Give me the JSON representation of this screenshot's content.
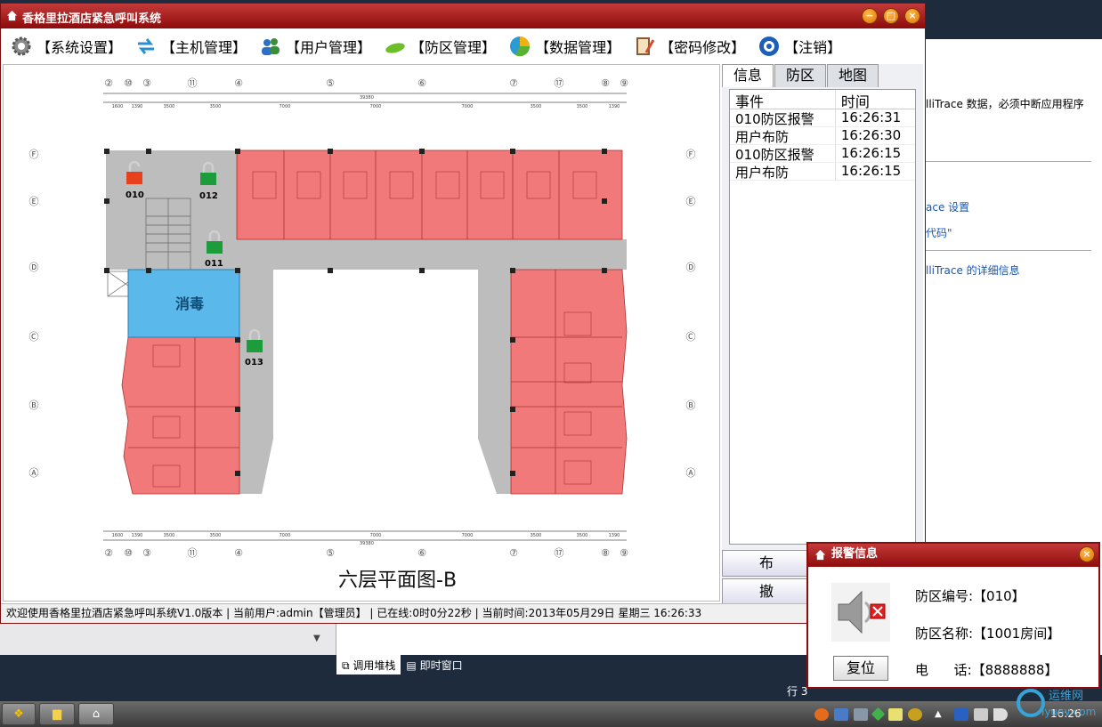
{
  "app": {
    "title": "香格里拉酒店紧急呼叫系统",
    "controls": {
      "minimize": "−",
      "maximize": "□",
      "close": "×"
    }
  },
  "menu": [
    {
      "label": "【系统设置】",
      "icon": "gear-icon"
    },
    {
      "label": "【主机管理】",
      "icon": "refresh-arrows-icon"
    },
    {
      "label": "【用户管理】",
      "icon": "users-icon"
    },
    {
      "label": "【防区管理】",
      "icon": "zone-icon"
    },
    {
      "label": "【数据管理】",
      "icon": "pie-chart-icon"
    },
    {
      "label": "【密码修改】",
      "icon": "notebook-pen-icon"
    },
    {
      "label": "【注销】",
      "icon": "logout-icon"
    }
  ],
  "floorplan": {
    "caption": "六层平面图-B",
    "disinfect_label": "消毒",
    "zones": [
      {
        "id": "010",
        "state": "alarm"
      },
      {
        "id": "012",
        "state": "armed"
      },
      {
        "id": "011",
        "state": "armed"
      },
      {
        "id": "013",
        "state": "armed"
      }
    ],
    "axis_top": [
      "②",
      "⑩",
      "③",
      "⑪",
      "④",
      "⑤",
      "⑥",
      "⑦",
      "⑰",
      "⑧",
      "⑨"
    ],
    "axis_side": [
      "Ⓕ",
      "Ⓔ",
      "Ⓓ",
      "Ⓒ",
      "Ⓑ",
      "Ⓐ"
    ],
    "dims_top": [
      "1600",
      "1390",
      "3500",
      "3500",
      "7000",
      "7000",
      "7000",
      "3500",
      "3500",
      "1390"
    ],
    "overall_dim": "39380"
  },
  "right_panel": {
    "tabs": [
      "信息",
      "防区",
      "地图"
    ],
    "active_tab": "信息",
    "columns": [
      "事件",
      "时间"
    ],
    "rows": [
      {
        "event": "010防区报警",
        "time": "16:26:31"
      },
      {
        "event": "用户布防",
        "time": "16:26:30"
      },
      {
        "event": "010防区报警",
        "time": "16:26:15"
      },
      {
        "event": "用户布防",
        "time": "16:26:15"
      }
    ],
    "btn_arm": "布",
    "btn_disarm": "撤"
  },
  "status": {
    "text": "欢迎使用香格里拉酒店紧急呼叫系统V1.0版本 | 当前用户:admin【管理员】 | 已在线:0时0分22秒 | 当前时间:2013年05月29日 星期三 16:26:33"
  },
  "alarm_popup": {
    "title": "报警信息",
    "zone_no": "防区编号:【010】",
    "zone_name": "防区名称:【1001房间】",
    "phone": "电      话:【8888888】",
    "reset": "复位"
  },
  "ide": {
    "line1": "lliTrace 数据，必须中断应用程序",
    "link1": "ace 设置",
    "link2": "代码\"",
    "link3": "lliTrace 的详细信息",
    "tab_callstack": "调用堆栈",
    "tab_immediate": "即时窗口",
    "line_label": "行 3"
  },
  "taskbar": {
    "clock": "16:26"
  },
  "watermark": {
    "text": "运维网",
    "sub": "iyunv.com"
  },
  "colors": {
    "title_red": "#8e0b0b",
    "room_red": "#f06a6a",
    "disinfect_blue": "#5bb8ea",
    "corridor_gray": "#bdbdbd",
    "lock_green": "#1c9c3a"
  }
}
